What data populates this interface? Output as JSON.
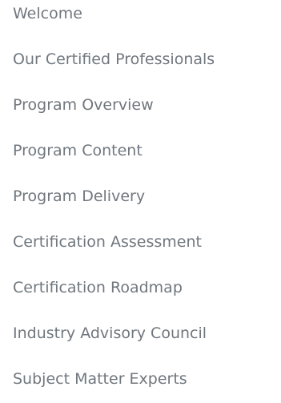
{
  "nav": {
    "items": [
      {
        "label": "Welcome"
      },
      {
        "label": "Our Certified Professionals"
      },
      {
        "label": "Program Overview"
      },
      {
        "label": "Program Content"
      },
      {
        "label": "Program Delivery"
      },
      {
        "label": "Certification Assessment"
      },
      {
        "label": "Certification Roadmap"
      },
      {
        "label": "Industry Advisory Council"
      },
      {
        "label": "Subject Matter Experts"
      }
    ]
  },
  "colors": {
    "link_text": "#70777e",
    "background": "#ffffff"
  }
}
